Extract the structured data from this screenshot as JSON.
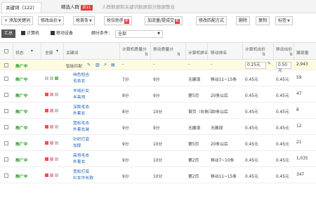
{
  "tabs": [
    {
      "label": "关键词（122）",
      "active": true
    },
    {
      "label": "精选人群",
      "badge": "双11"
    },
    {
      "label": "人群数据和关键词数据部分数据整合"
    }
  ],
  "toolbar": {
    "add": "+ 添加关键词",
    "modify_bid": "修改出价",
    "rank": "抢首条",
    "bid_helper": "抢位助手",
    "new": "新",
    "add_traffic": "加流量/提成交",
    "match": "修改匹配方式",
    "delete": "删除",
    "copy": "复制",
    "tag": "标签"
  },
  "filter": {
    "total": "汇总",
    "computer": "计算机",
    "mobile": "移动设备",
    "condition_label": "细分条件：",
    "condition_value": "全部"
  },
  "columns": {
    "state": "状态",
    "all": "全部",
    "keyword": "关键词",
    "pc_quality": "计算机质量分",
    "mobile_quality": "移动质量分",
    "pc_rank": "计算机排名",
    "mobile_rank": "移动排名",
    "pc_bid": "计算机出价",
    "mobile_bid": "移动出价",
    "impressions": "展现量"
  },
  "summary": {
    "label": "推广中",
    "smart_match": "智能匹配",
    "pc_quality": "-",
    "mobile_quality": "-",
    "pc_rank": "-",
    "mobile_rank": "-",
    "pc_bid": "0.25元",
    "mobile_bid": "0.50元",
    "impressions": "2,943"
  },
  "rows": [
    {
      "state": "推广中",
      "kw1": "纯色短吉",
      "kw2": "毛衣女",
      "pcq": "7分",
      "mq": "9分",
      "pcr": "无展现",
      "mr": "移动11~15条",
      "pcb": "0.45元",
      "mb": "0.45元",
      "imp": "59"
    },
    {
      "state": "推广中",
      "kw1": "羊绒衫女",
      "kw2": "半高领",
      "pcq": "8分",
      "mq": "9分",
      "pcr": "第5页",
      "mr": "20条以后",
      "pcb": "0.45元",
      "mb": "0.45元",
      "imp": "47"
    },
    {
      "state": "推广中",
      "kw1": "深款毛衣",
      "kw2": "外套女",
      "pcq": "8分",
      "mq": "10分",
      "pcr": "首页（右侧三）",
      "mr": "20条以后",
      "pcb": "0.45元",
      "mb": "0.45元",
      "imp": "8"
    },
    {
      "state": "推广中",
      "kw1": "宽松毛衣",
      "kw2": "外套女装",
      "pcq": "9分",
      "mq": "9分",
      "pcr": "无展现",
      "mr": "无展现",
      "pcb": "0.45元",
      "mb": "0.45元",
      "imp": "12"
    },
    {
      "state": "推广中",
      "kw1": "针织打底",
      "kw2": "加厚",
      "pcq": "9分",
      "mq": "10分",
      "pcr": "第5页",
      "mr": "20条以后",
      "pcb": "0.45元",
      "mb": "0.45元",
      "imp": "21"
    },
    {
      "state": "推广中",
      "kw1": "高领毛衣",
      "kw2": "外套女",
      "pcq": "9分",
      "mq": "10分",
      "pcr": "第2页",
      "mr": "移动7~10条",
      "pcb": "0.45元",
      "mb": "0.45元",
      "imp": "1,035"
    },
    {
      "state": "推广中",
      "kw1": "宽松打底",
      "kw2": "衫女中长款",
      "pcq": "9分",
      "mq": "10分",
      "pcr": "第2页",
      "mr": "移动11~15条",
      "pcb": "0.45元",
      "mb": "0.45元",
      "imp": "347"
    }
  ],
  "colors": {
    "status_green": "#2a9d2a",
    "link_blue": "#1a62b8",
    "badge_red": "#e4393c",
    "dot_red": "#f04d4d",
    "dot_pink": "#f3a0a0",
    "dot_gray": "#c9c9c9",
    "dot_green": "#6cc56c",
    "summary_bg": "#fffbe0"
  }
}
